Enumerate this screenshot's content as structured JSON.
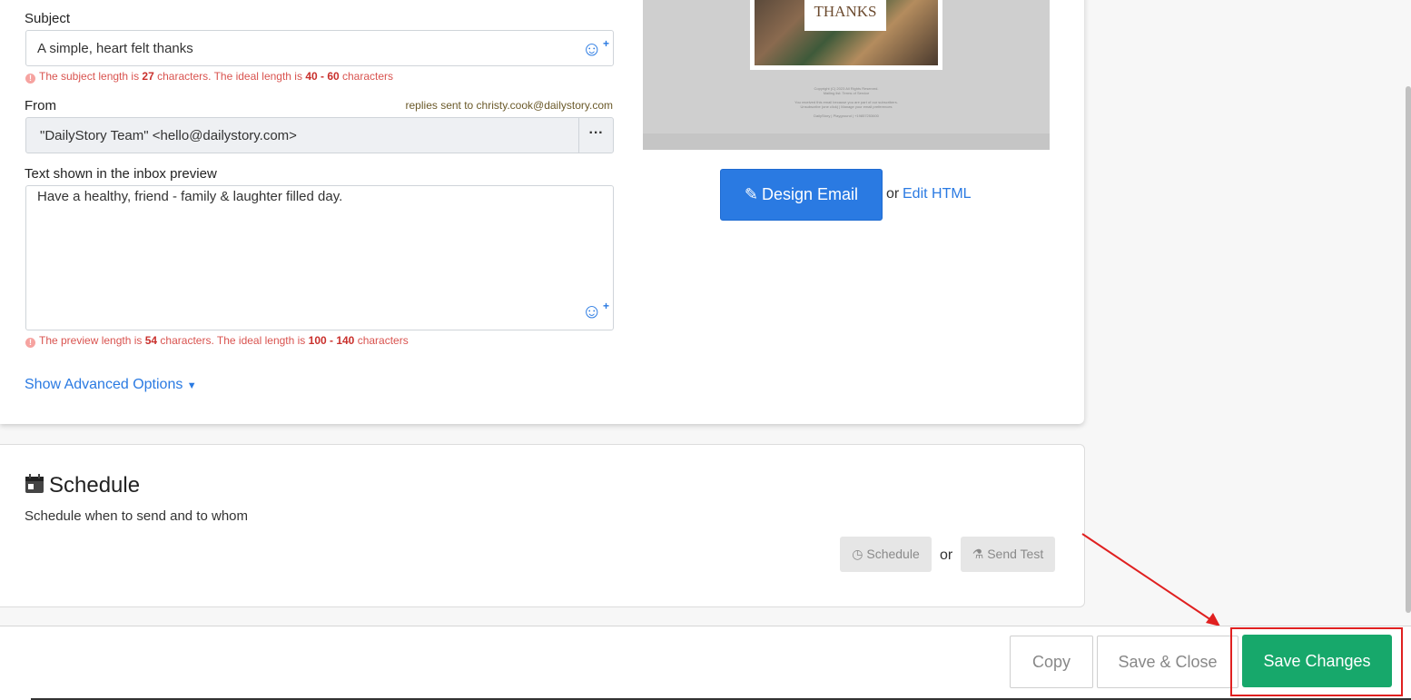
{
  "form": {
    "subject_label": "Subject",
    "subject_value": "A simple, heart felt thanks",
    "subject_warning": {
      "pre": "The subject length is ",
      "count": "27",
      "mid": " characters. The ideal length is ",
      "range": "40 - 60",
      "post": " characters"
    },
    "from_label": "From",
    "replies_note": "replies sent to christy.cook@dailystory.com",
    "from_value": "\"DailyStory Team\" <hello@dailystory.com>",
    "from_menu": "···",
    "preview_label": "Text shown in the inbox preview",
    "preview_value": "Have a healthy, friend - family & laughter filled day.",
    "preview_warning": {
      "pre": "The preview length is ",
      "count": "54",
      "mid": " characters. The ideal length is ",
      "range": "100 - 140",
      "post": " characters"
    },
    "advanced_options": "Show Advanced Options",
    "emoji_plus": "+"
  },
  "email_preview": {
    "badge_text": "THANKS",
    "footer_lines": [
      "Copyright (C) 2023 All Rights Reserved.",
      "Mailing list: Terms of Service",
      "",
      "You received this email because you are part of our subscribers.",
      "Unsubscribe (one click) | Manage your email preferences",
      "",
      "DailyStory | Playground | +19857253600"
    ]
  },
  "design": {
    "design_button": "Design Email",
    "or_text": "or",
    "edit_html": "Edit HTML"
  },
  "schedule": {
    "title": "Schedule",
    "subtitle": "Schedule when to send and to whom",
    "schedule_button": "Schedule",
    "or_text": "or",
    "send_test_button": "Send Test"
  },
  "footer": {
    "copy": "Copy",
    "save_close": "Save & Close",
    "save_changes": "Save Changes"
  },
  "colors": {
    "primary": "#2a7ae2",
    "success": "#17a86b",
    "warning": "#d9534f",
    "highlight": "#e02020"
  }
}
